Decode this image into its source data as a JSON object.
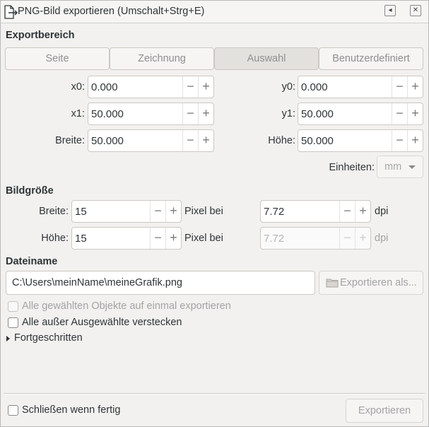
{
  "window": {
    "title": "PNG-Bild exportieren (Umschalt+Strg+E)",
    "pin_glyph": "◂",
    "close_glyph": "✕"
  },
  "export_area": {
    "heading": "Exportbereich",
    "tabs": [
      "Seite",
      "Zeichnung",
      "Auswahl",
      "Benutzerdefiniert"
    ],
    "active_tab": "Auswahl",
    "x0": {
      "label": "x0:",
      "value": "0.000"
    },
    "y0": {
      "label": "y0:",
      "value": "0.000"
    },
    "x1": {
      "label": "x1:",
      "value": "50.000"
    },
    "y1": {
      "label": "y1:",
      "value": "50.000"
    },
    "width": {
      "label": "Breite:",
      "value": "50.000"
    },
    "height": {
      "label": "Höhe:",
      "value": "50.000"
    },
    "units": {
      "label": "Einheiten:",
      "value": "mm"
    }
  },
  "image_size": {
    "heading": "Bildgröße",
    "width": {
      "label": "Breite:",
      "value": "15",
      "pixel_label": "Pixel bei",
      "dpi_value": "7.72",
      "dpi_label": "dpi"
    },
    "height": {
      "label": "Höhe:",
      "value": "15",
      "pixel_label": "Pixel bei",
      "dpi_value": "7.72",
      "dpi_label": "dpi"
    }
  },
  "filename": {
    "heading": "Dateiname",
    "path": "C:\\Users\\meinName\\meineGrafik.png",
    "export_as_label": "Exportieren als..."
  },
  "options": {
    "batch_export": "Alle gewählten Objekte auf einmal exportieren",
    "hide_others": "Alle außer Ausgewählte verstecken",
    "advanced": "Fortgeschritten"
  },
  "footer": {
    "close_when_done": "Schließen wenn fertig",
    "export_label": "Exportieren"
  },
  "spin_glyphs": {
    "minus": "−",
    "plus": "+"
  }
}
